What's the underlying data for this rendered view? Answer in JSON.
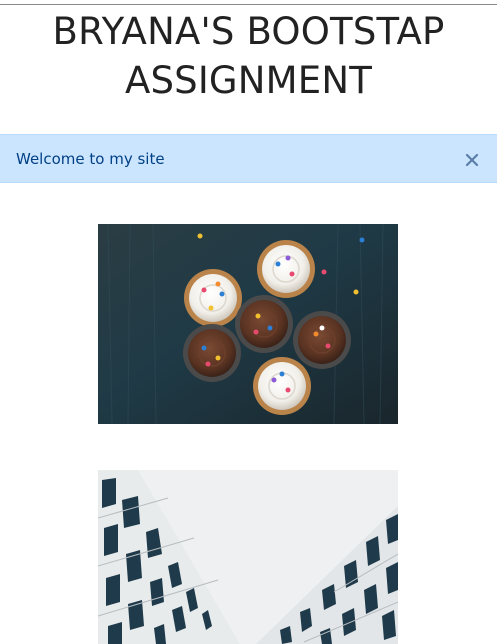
{
  "header": {
    "title_line1": "BRYANA'S BOOTSTAP",
    "title_line2": "ASSIGNMENT"
  },
  "alert": {
    "message": "Welcome to my site",
    "close_icon": "close-icon",
    "background": "#cce5ff",
    "text_color": "#004085"
  },
  "images": [
    {
      "name": "cupcakes-image"
    },
    {
      "name": "building-image"
    }
  ]
}
